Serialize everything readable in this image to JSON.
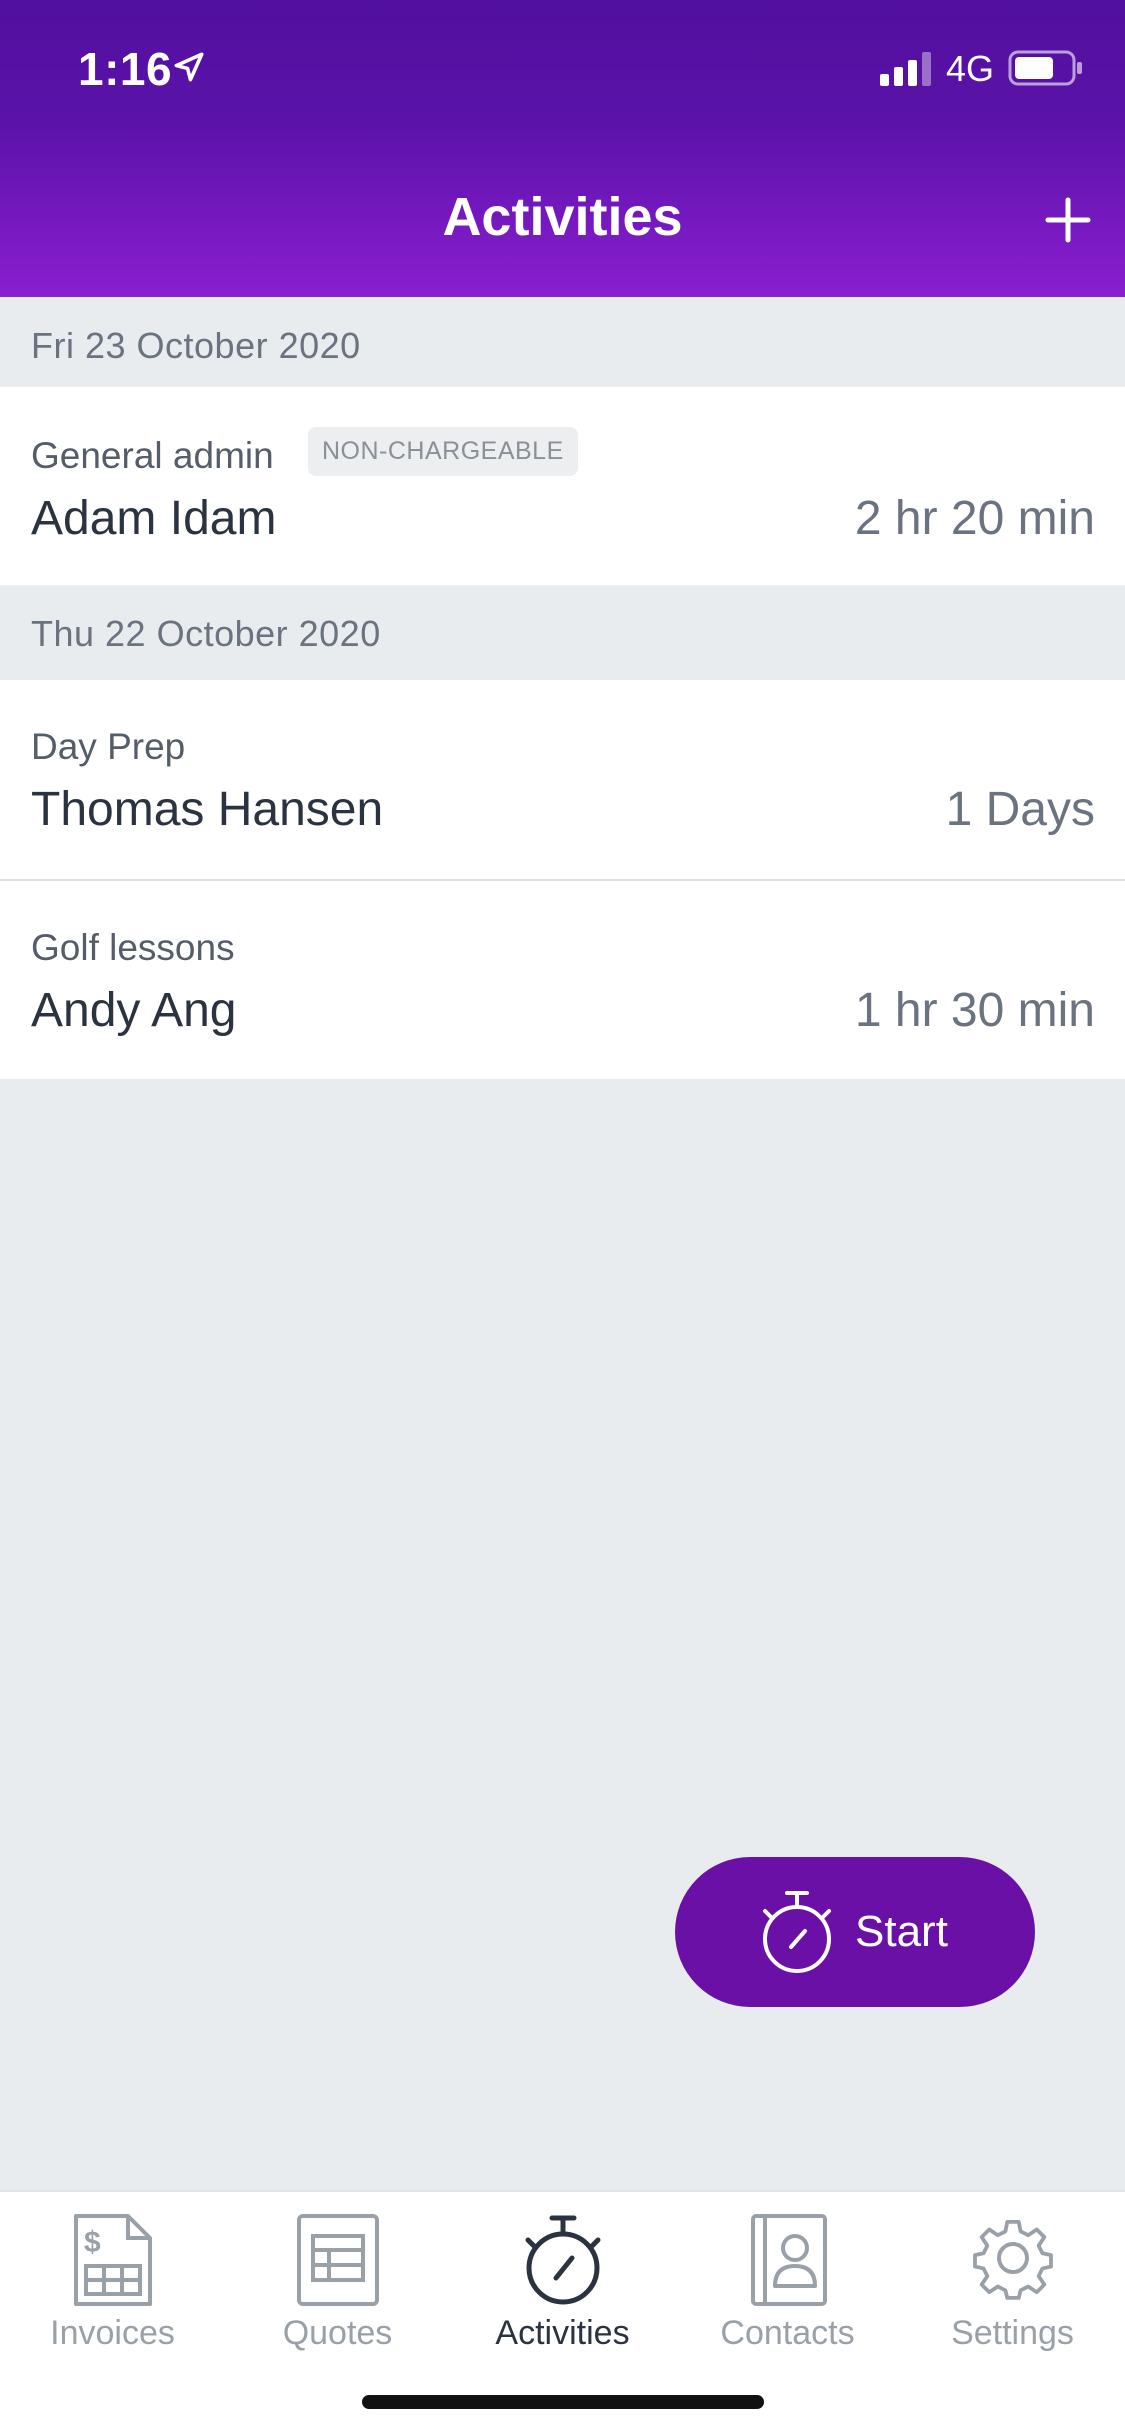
{
  "status_bar": {
    "time": "1:16",
    "network": "4G",
    "icons": [
      "location-arrow-icon",
      "signal-icon",
      "battery-icon"
    ]
  },
  "header": {
    "title": "Activities",
    "add_icon": "plus-icon"
  },
  "sections": [
    {
      "date": "Fri 23 October 2020",
      "items": [
        {
          "activity": "General admin",
          "badge": "NON-CHARGEABLE",
          "contact": "Adam Idam",
          "duration": "2 hr 20 min"
        }
      ]
    },
    {
      "date": "Thu 22 October 2020",
      "items": [
        {
          "activity": "Day Prep",
          "contact": "Thomas Hansen",
          "duration": "1 Days"
        },
        {
          "activity": "Golf lessons",
          "contact": "Andy Ang",
          "duration": "1 hr 30 min"
        }
      ]
    }
  ],
  "start_button": {
    "label": "Start",
    "icon": "stopwatch-icon"
  },
  "tabs": [
    {
      "label": "Invoices",
      "icon": "invoice-icon",
      "active": false
    },
    {
      "label": "Quotes",
      "icon": "quote-icon",
      "active": false
    },
    {
      "label": "Activities",
      "icon": "stopwatch-icon",
      "active": true
    },
    {
      "label": "Contacts",
      "icon": "contact-book-icon",
      "active": false
    },
    {
      "label": "Settings",
      "icon": "gear-icon",
      "active": false
    }
  ],
  "colors": {
    "header_top": "#52109f",
    "header_bottom": "#8a1ed0",
    "start_button": "#6a10a6",
    "background": "#e9ecef"
  }
}
